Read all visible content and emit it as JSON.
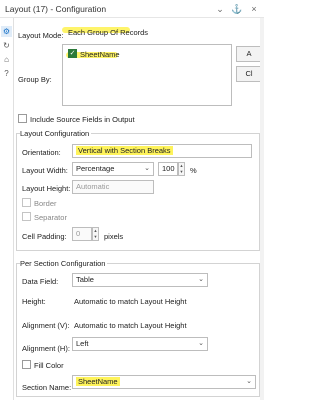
{
  "window": {
    "title": "Layout (17) - Configuration",
    "controls": {
      "minimize": "⌄",
      "pin": "⚓",
      "close": "×"
    }
  },
  "rail": {
    "icons": [
      "gear-icon",
      "circle-arrow-icon",
      "tag-icon",
      "question-icon"
    ]
  },
  "layout_mode": {
    "label": "Layout Mode:",
    "value": "Each Group Of Records"
  },
  "group_by": {
    "label": "Group By:",
    "items": [
      {
        "label": "SheetName",
        "checked": true
      }
    ],
    "buttons": [
      "A",
      "Cl"
    ]
  },
  "include_source": {
    "label": "Include Source Fields in Output",
    "checked": false
  },
  "layout_config": {
    "title": "Layout Configuration",
    "orientation": {
      "label": "Orientation:",
      "value": "Vertical with Section Breaks"
    },
    "layout_width": {
      "label": "Layout Width:",
      "value": "Percentage",
      "number": "100",
      "unit": "%"
    },
    "layout_height": {
      "label": "Layout Height:",
      "value": "Automatic"
    },
    "border": {
      "label": "Border",
      "checked": false
    },
    "separator": {
      "label": "Separator",
      "checked": false
    },
    "cell_padding": {
      "label": "Cell Padding:",
      "value": "0",
      "unit": "pixels"
    }
  },
  "section_config": {
    "title": "Per Section Configuration",
    "data_field": {
      "label": "Data Field:",
      "value": "Table"
    },
    "height": {
      "label": "Height:",
      "value": "Automatic to match Layout Height"
    },
    "alignment_v": {
      "label": "Alignment (V):",
      "value": "Automatic to match Layout Height"
    },
    "alignment_h": {
      "label": "Alignment (H):",
      "value": "Left"
    },
    "fill_color": {
      "label": "Fill Color",
      "checked": false
    },
    "section_name": {
      "label": "Section Name:",
      "value": "SheetName"
    }
  },
  "colors": {
    "highlight": "#fef35a",
    "accent": "#1a73c9",
    "check": "#2c7a3a"
  }
}
